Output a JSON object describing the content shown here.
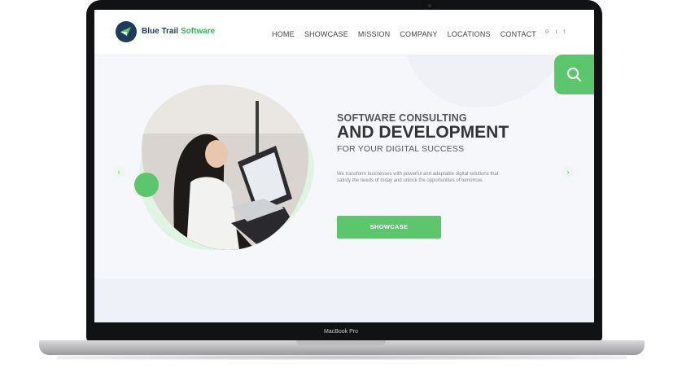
{
  "device": {
    "label": "MacBook Pro"
  },
  "site": {
    "logo": {
      "icon": "wing-logo-icon",
      "name_part1": "Blue Trail",
      "name_part2": "Software"
    },
    "nav": {
      "items": [
        "HOME",
        "SHOWCASE",
        "MISSION",
        "COMPANY",
        "LOCATIONS",
        "CONTACT"
      ]
    },
    "social": {
      "icons": [
        "google-icon",
        "twitter-icon",
        "facebook-icon"
      ],
      "glyphs": [
        "G",
        "t",
        "f"
      ]
    },
    "search": {
      "icon": "search-icon"
    },
    "hero": {
      "heading_line1": "SOFTWARE CONSULTING",
      "heading_line2": "AND DEVELOPMENT",
      "heading_line3": "FOR YOUR DIGITAL SUCCESS",
      "description": "We transform businesses with powerful and adaptable digital solutions that satisfy the needs of today and unlock the opportunities of tomorrow.",
      "cta_label": "SHOWCASE",
      "prev_icon": "chevron-left-icon",
      "next_icon": "chevron-right-icon",
      "prev_glyph": "‹",
      "next_glyph": "›",
      "image": "woman-working-on-laptop-photo"
    }
  },
  "colors": {
    "accent": "#5bc66b",
    "brand_dark": "#1f3b5a",
    "screen_bg": "#f6f7fb"
  }
}
